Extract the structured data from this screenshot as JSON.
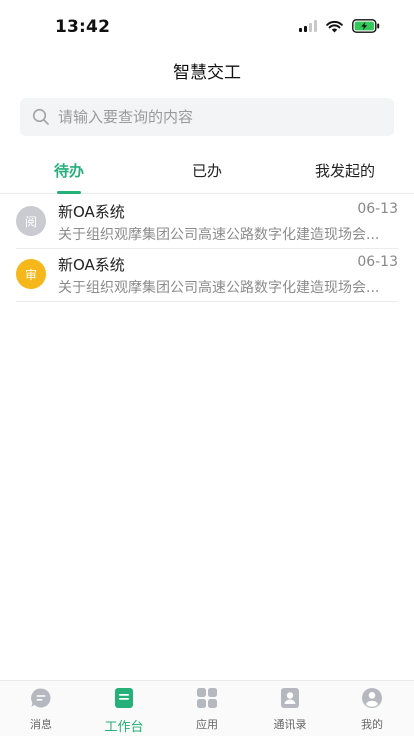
{
  "status_bar": {
    "time": "13:42"
  },
  "header": {
    "title": "智慧交工"
  },
  "search": {
    "placeholder": "请输入要查询的内容"
  },
  "tabs": [
    {
      "label": "待办",
      "active": true
    },
    {
      "label": "已办",
      "active": false
    },
    {
      "label": "我发起的",
      "active": false
    }
  ],
  "items": [
    {
      "avatar_text": "阅",
      "avatar_color": "#c9cbd1",
      "title": "新OA系统",
      "date": "06-13",
      "summary": "关于组织观摩集团公司高速公路数字化建造现场会..."
    },
    {
      "avatar_text": "审",
      "avatar_color": "#f5b719",
      "title": "新OA系统",
      "date": "06-13",
      "summary": "关于组织观摩集团公司高速公路数字化建造现场会..."
    }
  ],
  "tabbar": [
    {
      "label": "消息",
      "icon": "message-icon",
      "active": false
    },
    {
      "label": "工作台",
      "icon": "workbench-icon",
      "active": true
    },
    {
      "label": "应用",
      "icon": "apps-grid-icon",
      "active": false
    },
    {
      "label": "通讯录",
      "icon": "contacts-icon",
      "active": false
    },
    {
      "label": "我的",
      "icon": "profile-icon",
      "active": false
    }
  ],
  "colors": {
    "accent": "#25b07a",
    "inactive_icon": "#b5b8be"
  }
}
